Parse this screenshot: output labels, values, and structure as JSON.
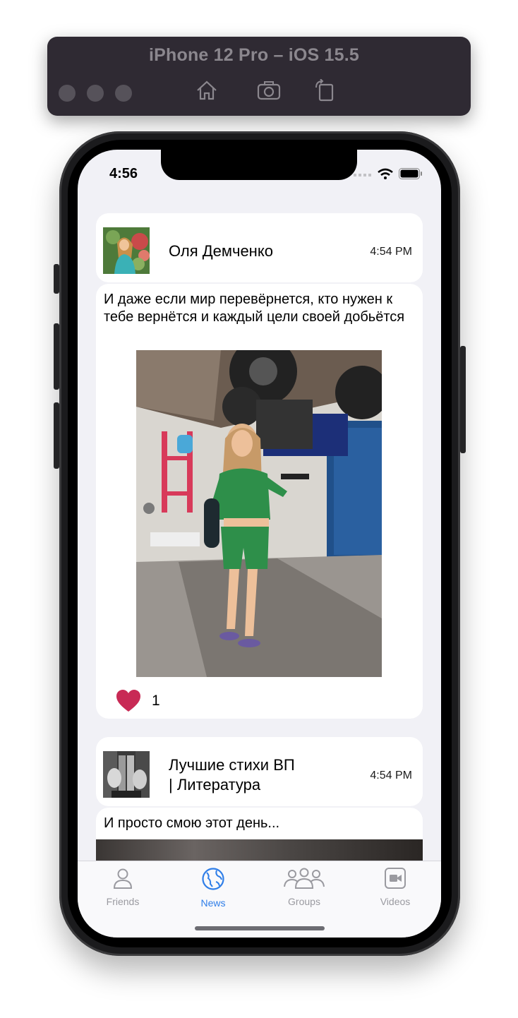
{
  "simulator": {
    "title": "iPhone 12 Pro – iOS 15.5"
  },
  "status_bar": {
    "time": "4:56"
  },
  "posts": [
    {
      "author": "Оля Демченко",
      "time": "4:54 PM",
      "text": "И даже если мир перевёрнется, кто нужен к тебе вернётся и каждый цели своей добьётся",
      "likes": "1"
    },
    {
      "author_line1": "Лучшие стихи ВП",
      "author_line2": "| Литература",
      "time": "4:54 PM",
      "text": "И просто смою этот день..."
    }
  ],
  "tabbar": {
    "items": [
      {
        "label": "Friends",
        "icon": "person-icon"
      },
      {
        "label": "News",
        "icon": "globe-icon",
        "active": true
      },
      {
        "label": "Groups",
        "icon": "groups-icon"
      },
      {
        "label": "Videos",
        "icon": "video-icon"
      }
    ]
  },
  "colors": {
    "accent": "#2f7ee8",
    "like": "#c82a55",
    "screen_bg": "#f1f1f6"
  }
}
